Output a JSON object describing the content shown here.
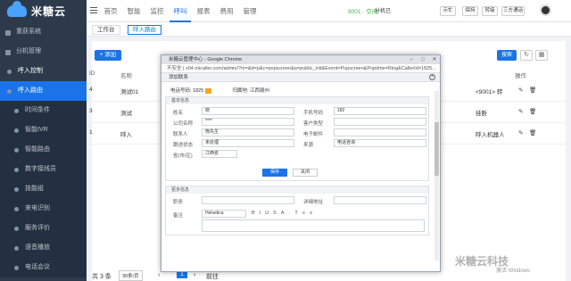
{
  "app": {
    "logo": "米糖云"
  },
  "topnav": [
    "首页",
    "智能",
    "监控",
    "呼叫",
    "报表",
    "费用",
    "管理"
  ],
  "topbar": {
    "status": "9001 · 空闲",
    "ext": "分机已 ",
    "buttons": [
      "示忙",
      "保持",
      "转接",
      "三方通话"
    ]
  },
  "sidebar": [
    {
      "label": "重获系统",
      "kind": "group"
    },
    {
      "label": "分机管理",
      "kind": "group"
    },
    {
      "label": "呼入控制",
      "kind": "parent"
    },
    {
      "label": "呼入路由",
      "kind": "active"
    },
    {
      "label": "时间条件",
      "kind": "sub"
    },
    {
      "label": "智能IVR",
      "kind": "sub"
    },
    {
      "label": "智能路由",
      "kind": "sub"
    },
    {
      "label": "数字接线员",
      "kind": "sub"
    },
    {
      "label": "技能组",
      "kind": "sub"
    },
    {
      "label": "来电识别",
      "kind": "sub"
    },
    {
      "label": "服务评价",
      "kind": "sub"
    },
    {
      "label": "语音播放",
      "kind": "sub"
    },
    {
      "label": "电话会议",
      "kind": "sub"
    }
  ],
  "tabs": [
    "工作台",
    "呼入路由"
  ],
  "toolbar": {
    "add": "+ 添加",
    "search": "搜索"
  },
  "table": {
    "headers": [
      "ID",
      "名称",
      "操作"
    ],
    "rows": [
      {
        "id": "4",
        "name": "测试01",
        "target": "<9001> 转"
      },
      {
        "id": "3",
        "name": "测试",
        "target": "挂断"
      },
      {
        "id": "1",
        "name": "呼入",
        "target": "呼入机器人"
      }
    ]
  },
  "pager": {
    "total": "共 3 条",
    "pagesize": "30条/页",
    "page": "1",
    "goto": "前往"
  },
  "browser": {
    "title": "米糖云管理中心 - Google Chrome",
    "url": "不安全 | x04.micaller.com/admin/?m=&d=p&c=popscreen&a=public_init&Event=Popscreen&Poptime=Ring&CallerId=1825..."
  },
  "modal": {
    "title": "添加联系",
    "phone_label": "电话号码:",
    "phone_value": "1825",
    "location_label": "归属地:",
    "location_value": "江西赣州",
    "sec1": "基本信息",
    "fields": {
      "name": "姓名",
      "name_val": "晓",
      "mobile": "手机号码",
      "mobile_val": "182",
      "company": "公司名称",
      "company_val": "****",
      "client_type": "客户类型",
      "contact": "联系人",
      "contact_val": "熊先生",
      "email": "电子邮件",
      "followup": "跟进状态",
      "followup_val": "未处理",
      "source": "来源",
      "source_val": "电话咨询",
      "province": "省(市/区)",
      "province_val": "江西省"
    },
    "save": "保存",
    "close": "关闭",
    "sec2": "更多信息",
    "more": {
      "qq": "职务",
      "address": "详细地址",
      "remark": "备注",
      "font": "Helvetica"
    }
  },
  "overlay": {
    "watermark": "米糖云科技",
    "activate": "激活 Windows"
  },
  "colors": {
    "accent": "#1a73e8",
    "sidebar": "#2d3a4b"
  }
}
